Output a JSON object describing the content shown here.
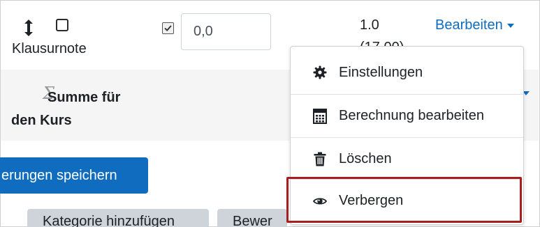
{
  "row1": {
    "item_name": "Klausurnote",
    "input_value": "0,0",
    "grade_value": "1.0",
    "grade_sub": "(17,00)",
    "edit_label": "Bearbeiten"
  },
  "row2": {
    "total_line1": "Summe für",
    "total_line2": "den Kurs"
  },
  "buttons": {
    "save_label": "erungen speichern",
    "grey1_label": "Kategorie hinzufügen",
    "grey2_label": "Bewer"
  },
  "menu": {
    "items": [
      {
        "label": "Einstellungen",
        "icon": "gear-icon"
      },
      {
        "label": "Berechnung bearbeiten",
        "icon": "calculator-icon"
      },
      {
        "label": "Löschen",
        "icon": "trash-icon"
      },
      {
        "label": "Verbergen",
        "icon": "eye-icon"
      }
    ]
  },
  "colors": {
    "link": "#0f6cbf",
    "primary_button": "#0f6cbf",
    "highlight": "#a81e1e"
  }
}
